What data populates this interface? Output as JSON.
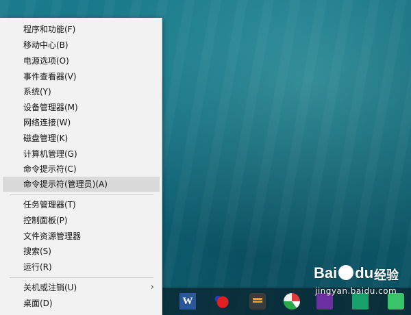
{
  "context_menu": {
    "items": [
      {
        "label": "程序和功能(F)"
      },
      {
        "label": "移动中心(B)"
      },
      {
        "label": "电源选项(O)"
      },
      {
        "label": "事件查看器(V)"
      },
      {
        "label": "系统(Y)"
      },
      {
        "label": "设备管理器(M)"
      },
      {
        "label": "网络连接(W)"
      },
      {
        "label": "磁盘管理(K)"
      },
      {
        "label": "计算机管理(G)"
      },
      {
        "label": "命令提示符(C)"
      },
      {
        "label": "命令提示符(管理员)(A)",
        "highlighted": true
      },
      {
        "label": "任务管理器(T)"
      },
      {
        "label": "控制面板(P)"
      },
      {
        "label": "文件资源管理器"
      },
      {
        "label": "搜索(S)"
      },
      {
        "label": "运行(R)"
      },
      {
        "label": "关机或注销(U)",
        "submenu_arrow": "›"
      },
      {
        "label": "桌面(D)"
      }
    ]
  },
  "taskbar": {
    "icons": [
      "word-icon",
      "paint-icon",
      "sublime-text-icon",
      "pinwheel-icon",
      "onenote-icon",
      "app-icon",
      "green-app-icon"
    ],
    "word_letter": "W"
  },
  "watermark": {
    "brand": "Bai",
    "brand_suffix": "du",
    "product": "经验",
    "url": "jingyan.baidu.com"
  },
  "colors": {
    "menu_bg": "#f2f2f2",
    "highlight": "#dadada",
    "desktop_teal": "#137283"
  }
}
